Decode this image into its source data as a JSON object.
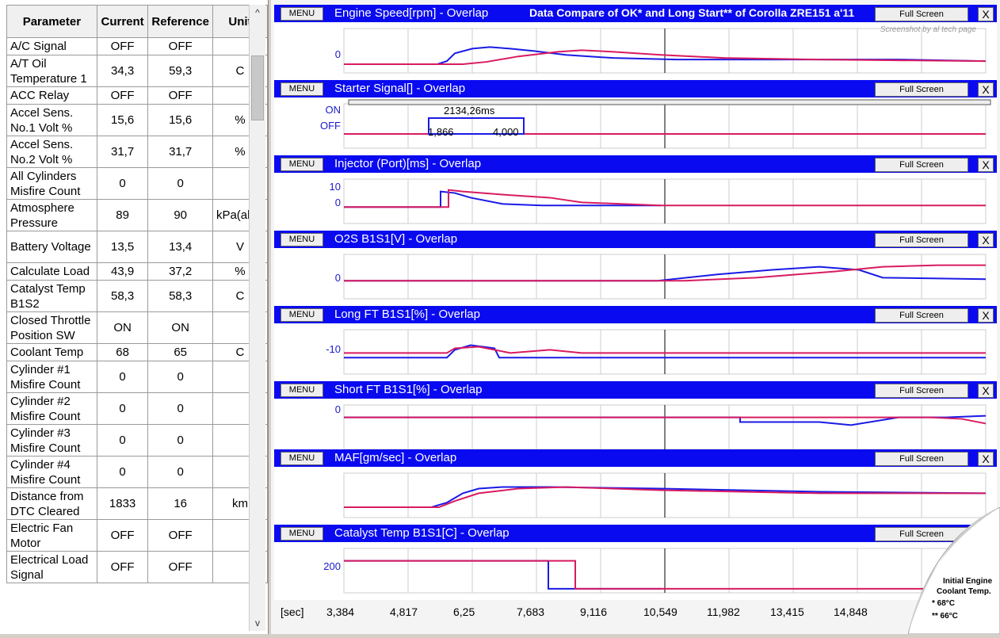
{
  "table": {
    "headers": [
      "Parameter",
      "Current",
      "Reference",
      "Unit"
    ],
    "rows": [
      [
        "A/C Signal",
        "OFF",
        "OFF",
        ""
      ],
      [
        "A/T Oil Temperature 1",
        "34,3",
        "59,3",
        "C"
      ],
      [
        "ACC Relay",
        "OFF",
        "OFF",
        ""
      ],
      [
        "Accel Sens. No.1 Volt %",
        "15,6",
        "15,6",
        "%"
      ],
      [
        "Accel Sens. No.2 Volt %",
        "31,7",
        "31,7",
        "%"
      ],
      [
        "All Cylinders Misfire Count",
        "0",
        "0",
        ""
      ],
      [
        "Atmosphere Pressure",
        "89",
        "90",
        "kPa(abs)"
      ],
      [
        "Battery Voltage",
        "13,5",
        "13,4",
        "V"
      ],
      [
        "Calculate Load",
        "43,9",
        "37,2",
        "%"
      ],
      [
        "Catalyst Temp B1S2",
        "58,3",
        "58,3",
        "C"
      ],
      [
        "Closed Throttle Position SW",
        "ON",
        "ON",
        ""
      ],
      [
        "Coolant Temp",
        "68",
        "65",
        "C"
      ],
      [
        "Cylinder #1 Misfire Count",
        "0",
        "0",
        ""
      ],
      [
        "Cylinder #2 Misfire Count",
        "0",
        "0",
        ""
      ],
      [
        "Cylinder #3 Misfire Count",
        "0",
        "0",
        ""
      ],
      [
        "Cylinder #4 Misfire Count",
        "0",
        "0",
        ""
      ],
      [
        "Distance from DTC Cleared",
        "1833",
        "16",
        "km"
      ],
      [
        "Electric Fan Motor",
        "OFF",
        "OFF",
        ""
      ],
      [
        "Electrical Load Signal",
        "OFF",
        "OFF",
        ""
      ]
    ]
  },
  "scroll": {
    "up": "^",
    "down": "v"
  },
  "buttons": {
    "menu": "MENU",
    "full_screen": "Full Screen",
    "close": "X"
  },
  "compare_title": "Data Compare of OK* and Long Start** of Corolla ZRE151 a'11",
  "watermark": "Screenshot by al tech page",
  "panels": [
    {
      "title": "Engine Speed[rpm] - Overlap",
      "ylabels": [
        "0"
      ]
    },
    {
      "title": "Starter Signal[] - Overlap",
      "ylabels": [
        "ON",
        "OFF"
      ],
      "measure": {
        "duration": "2134,26ms",
        "start": "1,866",
        "end": "4,000"
      }
    },
    {
      "title": "Injector (Port)[ms] - Overlap",
      "ylabels": [
        "10",
        "0"
      ]
    },
    {
      "title": "O2S B1S1[V] - Overlap",
      "ylabels": [
        "0"
      ]
    },
    {
      "title": "Long FT B1S1[%] - Overlap",
      "ylabels": [
        "-10"
      ]
    },
    {
      "title": "Short FT B1S1[%] - Overlap",
      "ylabels": [
        "0"
      ]
    },
    {
      "title": "MAF[gm/sec] - Overlap",
      "ylabels": []
    },
    {
      "title": "Catalyst Temp B1S1[C] - Overlap",
      "ylabels": [
        "200"
      ]
    }
  ],
  "xaxis": {
    "unit": "[sec]",
    "ticks": [
      "3,384",
      "4,817",
      "6,25",
      "7,683",
      "9,116",
      "10,549",
      "11,982",
      "13,415",
      "14,848"
    ]
  },
  "note": {
    "title_line1": "Initial Engine",
    "title_line2": "Coolant Temp.",
    "ok": "* 68°C",
    "long": "** 66°C"
  },
  "colors": {
    "ok_series": "#1a1ae6",
    "long_series": "#d81b60",
    "titlebar": "#0a0af0"
  }
}
